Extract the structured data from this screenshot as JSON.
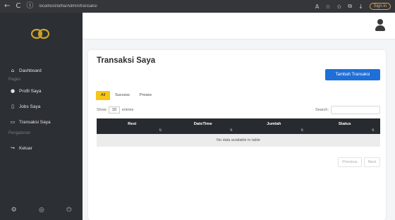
{
  "browser": {
    "back_glyph": "←",
    "reload_glyph": "C",
    "info_glyph": "ⓘ",
    "url": "localhost/laffia/Admin/transaksi",
    "glyph_read": "A",
    "glyph_star": "☆",
    "glyph_fav": "✩",
    "glyph_ext": "⧉",
    "glyph_dl": "↓",
    "signin": "Sign in"
  },
  "sidebar": {
    "nav": [
      {
        "icon": "home-icon",
        "glyph": "⌂",
        "label": "Dashboard"
      },
      {
        "icon": "users-icon",
        "glyph": "●",
        "label": "Profil Saya"
      },
      {
        "icon": "jobs-icon",
        "glyph": "▯",
        "label": "Jobs Saya"
      },
      {
        "icon": "transaction-icon",
        "glyph": "▭",
        "label": "Transaksi Saya"
      },
      {
        "icon": "logout-icon",
        "glyph": "↪",
        "label": "Keluar"
      }
    ],
    "heading_pages": "Pages",
    "heading_pengaturan": "Pengaturan",
    "bottom": [
      "⚙",
      "◎",
      "⏻"
    ]
  },
  "main": {
    "title": "Transaksi Saya",
    "add_button": "Tambah Transaksi",
    "tabs": [
      "All",
      "Success",
      "Proses"
    ],
    "show_label": "Show",
    "show_value": "10",
    "entries_label": "entries",
    "search_label": "Search:",
    "search_value": "",
    "columns": [
      "Resi",
      "DateTime",
      "Jumlah",
      "Status"
    ],
    "sort_glyph": "⇅",
    "empty_message": "No data available in table",
    "pager": {
      "prev": "Previous",
      "next": "Next"
    }
  },
  "colors": {
    "sidebar_bg": "#2c2f33",
    "accent_blue": "#1f6fd8",
    "tab_active": "#f5c518",
    "table_head": "#272a2e"
  }
}
